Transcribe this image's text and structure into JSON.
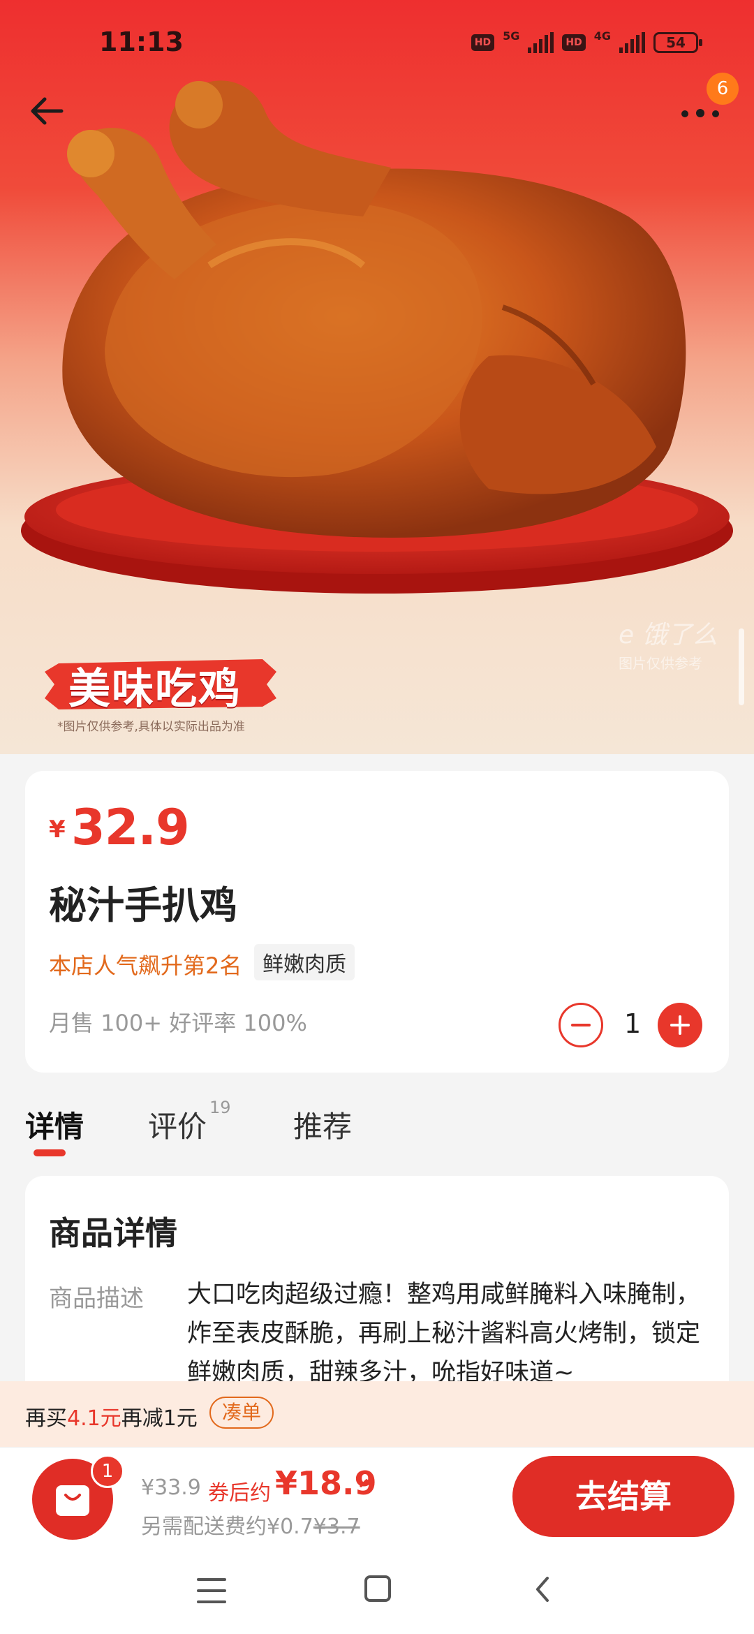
{
  "status_bar": {
    "time": "11:13",
    "hd1": "HD",
    "net1": "5G",
    "hd2": "HD",
    "net2": "4G",
    "battery": "54"
  },
  "header": {
    "more_badge": "6",
    "back_icon": "arrow-left-icon",
    "more_icon": "more-dots-icon"
  },
  "hero": {
    "promo_title": "美味吃鸡",
    "promo_note": "*图片仅供参考,具体以实际出品为准",
    "watermark_logo": "e 饿了么",
    "watermark_sub": "图片仅供参考"
  },
  "product": {
    "currency": "¥",
    "price": "32.9",
    "name": "秘汁手扒鸡",
    "rank": "本店人气飙升第2名",
    "tag": "鲜嫩肉质",
    "sales": "月售 100+ 好评率 100%",
    "quantity": "1"
  },
  "tabs": [
    {
      "label": "详情",
      "sup": ""
    },
    {
      "label": "评价",
      "sup": "19"
    },
    {
      "label": "推荐",
      "sup": ""
    }
  ],
  "details": {
    "title": "商品详情",
    "desc_label": "商品描述",
    "desc_text": "大口吃肉超级过瘾！整鸡用咸鲜腌料入味腌制，炸至表皮酥脆，再刷上秘汁酱料高火烤制，锁定鲜嫩肉质，甜辣多汁，吮指好味道~"
  },
  "promo_strip": {
    "text_before": "再买",
    "text_amount": "4.1元",
    "text_after": "再减1元",
    "button": "凑单"
  },
  "bottom_bar": {
    "cart_count": "1",
    "original_price": "¥33.9",
    "after_coupon_label": "券后约",
    "final_price": "¥18.9",
    "fee_text": "另需配送费约¥0.7",
    "fee_original": "¥3.7",
    "checkout": "去结算"
  },
  "colors": {
    "accent": "#e8372b",
    "orange": "#e2691c",
    "hero_top": "#ee2f2f"
  }
}
